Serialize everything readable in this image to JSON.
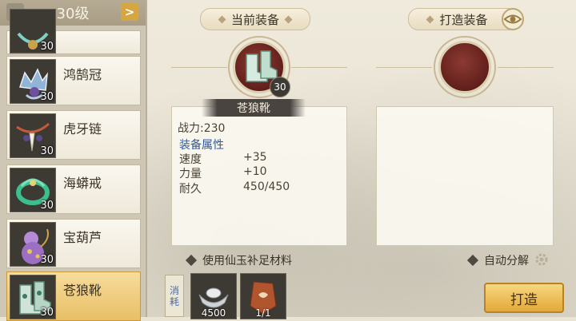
{
  "header": {
    "level_title": "30级",
    "prev_icon": "chevron-left-icon",
    "next_icon": "chevron-right-icon"
  },
  "items": [
    {
      "name": "",
      "level": "30",
      "icon": "necklace-icon"
    },
    {
      "name": "鸿鹄冠",
      "level": "30",
      "icon": "crown-icon"
    },
    {
      "name": "虎牙链",
      "level": "30",
      "icon": "tooth-chain-icon"
    },
    {
      "name": "海蟒戒",
      "level": "30",
      "icon": "ring-icon"
    },
    {
      "name": "宝葫芦",
      "level": "30",
      "icon": "gourd-icon"
    },
    {
      "name": "苍狼靴",
      "level": "30",
      "icon": "boots-icon",
      "selected": true
    }
  ],
  "current": {
    "title": "当前装备",
    "item_name": "苍狼靴",
    "level": "30",
    "power_label": "战力:230",
    "attr_header": "装备属性",
    "attributes": [
      {
        "name": "速度",
        "value": "+35"
      },
      {
        "name": "力量",
        "value": "+10"
      },
      {
        "name": "耐久",
        "value": "450/450"
      }
    ]
  },
  "forge": {
    "title": "打造装备",
    "eye_icon": "eye-icon",
    "auto_decompose": "自动分解",
    "forge_button": "打造"
  },
  "options": {
    "use_jade": "使用仙玉补足材料"
  },
  "consume": {
    "label": "消耗"
  },
  "materials": [
    {
      "icon": "silver-ingot-icon",
      "count": "4500"
    },
    {
      "icon": "leather-material-icon",
      "count": "1/1"
    }
  ]
}
